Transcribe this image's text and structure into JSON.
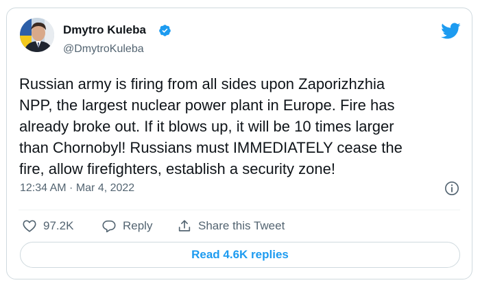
{
  "author": {
    "name": "Dmytro Kuleba",
    "handle": "@DmytroKuleba",
    "verified": true,
    "avatar_icon": "profile-photo"
  },
  "tweet": {
    "text": "Russian army is firing from all sides upon Zaporizhzhia\nNPP, the largest nuclear power plant in Europe. Fire has\nalready broke out. If it blows up, it will be 10 times larger\nthan Chornobyl! Russians must IMMEDIATELY cease the\nfire, allow firefighters, establish a security zone!",
    "timestamp": "12:34 AM · Mar 4, 2022"
  },
  "actions": {
    "like_count": "97.2K",
    "reply_label": "Reply",
    "share_label": "Share this Tweet"
  },
  "read_replies_label": "Read 4.6K replies",
  "icons": {
    "logo": "twitter-bird-icon",
    "verified": "verified-badge-icon",
    "info": "info-icon",
    "like": "heart-icon",
    "reply": "reply-bubble-icon",
    "share": "share-upload-icon"
  },
  "colors": {
    "brand": "#1d9bf0",
    "text_primary": "#0f1419",
    "text_secondary": "#536471",
    "border": "#cfd9de"
  }
}
